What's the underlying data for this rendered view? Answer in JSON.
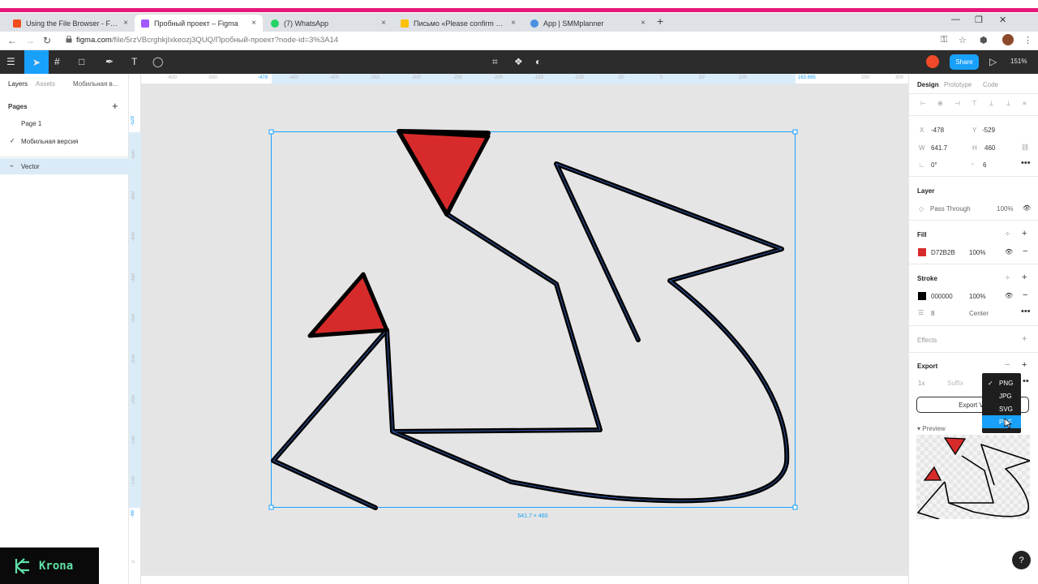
{
  "browser": {
    "tabs": [
      {
        "title": "Using the File Browser - Figma",
        "close": "×"
      },
      {
        "title": "Пробный проект – Figma",
        "close": "×"
      },
      {
        "title": "(7) WhatsApp",
        "close": "×"
      },
      {
        "title": "Письмо «Please confirm your email»",
        "close": "×"
      },
      {
        "title": "App | SMMplanner",
        "close": "×"
      }
    ],
    "new_tab": "+",
    "url_host": "figma.com",
    "url_path": "/file/5rzVBcrghkjIxkeozj3QUQ/Пробный-проект?node-id=3%3A14"
  },
  "toolbar": {
    "share_label": "Share",
    "zoom_label": "151%"
  },
  "left_panel": {
    "tabs": [
      "Layers",
      "Assets",
      "Мобильная в..."
    ],
    "pages_header": "Pages",
    "add_page": "+",
    "pages": [
      {
        "name": "Page 1",
        "checked": false
      },
      {
        "name": "Мобильная версия",
        "checked": true
      }
    ],
    "layers": [
      {
        "name": "Vector"
      }
    ]
  },
  "rulers": {
    "horizontal": [
      "-600",
      "-550",
      "-478",
      "-450",
      "-400",
      "-350",
      "-300",
      "-250",
      "-200",
      "-150",
      "-100",
      "-50",
      "0",
      "50",
      "100",
      "163.695",
      "250",
      "300"
    ],
    "vertical": [
      "-529",
      "-500",
      "-450",
      "-400",
      "-350",
      "-300",
      "-250",
      "-200",
      "-150",
      "-100",
      "-69",
      "0"
    ]
  },
  "canvas": {
    "selection_size": "641.7 × 460",
    "fill_color": "#D72B2B",
    "stroke_color": "#000000"
  },
  "right_panel": {
    "tabs": [
      "Design",
      "Prototype",
      "Code"
    ],
    "x_label": "X",
    "x_value": "-478",
    "y_label": "Y",
    "y_value": "-529",
    "w_label": "W",
    "w_value": "641.7",
    "h_label": "H",
    "h_value": "460",
    "rotation_value": "0°",
    "radius_value": "6",
    "layer_header": "Layer",
    "blend_mode": "Pass Through",
    "layer_opacity": "100%",
    "fill_header": "Fill",
    "fill_hex": "D72B2B",
    "fill_opacity": "100%",
    "stroke_header": "Stroke",
    "stroke_hex": "000000",
    "stroke_opacity": "100%",
    "stroke_weight": "8",
    "stroke_align": "Center",
    "effects_header": "Effects",
    "export_header": "Export",
    "export_scale": "1x",
    "export_suffix_placeholder": "Suffix",
    "export_button": "Export Ve",
    "preview_label": "Preview"
  },
  "dropdown": {
    "options": [
      "PNG",
      "JPG",
      "SVG",
      "PDF"
    ],
    "selected": "PNG",
    "hovered": "PDF"
  },
  "watermark": {
    "text": "Krona"
  },
  "help_label": "?"
}
